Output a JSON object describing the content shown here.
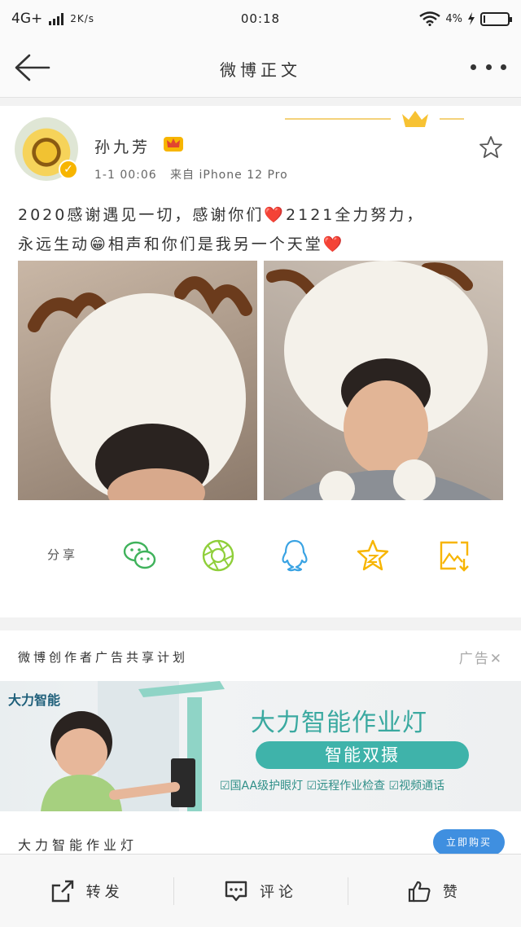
{
  "status_bar": {
    "network": "4G+",
    "speed": "2K/s",
    "time": "00:18",
    "battery": "4%"
  },
  "nav": {
    "title": "微博正文"
  },
  "post": {
    "username": "孙九芳",
    "time": "1-1 00:06",
    "source": "来自 iPhone 12 Pro",
    "text_line1": "2020感谢遇见一切，感谢你们❤️2121全力努力，",
    "text_line2": "永远生动😁相声和你们是我另一个天堂❤️"
  },
  "share": {
    "label": "分享",
    "icons": [
      "wechat-icon",
      "moments-icon",
      "qq-icon",
      "favorite-icon",
      "save-image-icon"
    ]
  },
  "ad": {
    "header": "微博创作者广告共享计划",
    "close_label": "广告✕",
    "brand": "大力智能",
    "product": "大力智能作业灯",
    "pill": "智能双摄",
    "features": "☑国AA级护眼灯 ☑远程作业检查 ☑视频通话",
    "title": "大力智能作业灯",
    "button": "立即购买"
  },
  "bottom_bar": {
    "repost": "转发",
    "comment": "评论",
    "like": "赞"
  },
  "colors": {
    "accent_orange": "#f7b500",
    "wechat_green": "#3fb25b",
    "moments_green": "#8fcf3a",
    "qq_blue": "#3aa3e3",
    "star_yellow": "#f7b500",
    "ad_teal": "#3fb3aa"
  }
}
